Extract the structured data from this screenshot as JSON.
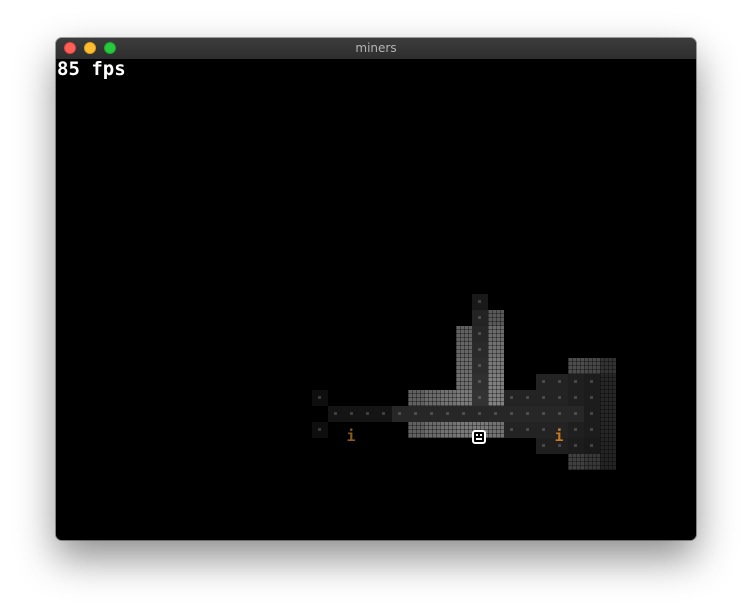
{
  "window": {
    "title": "miners"
  },
  "hud": {
    "fps_text": "85 fps"
  },
  "colors": {
    "torch": "#c87820",
    "player": "#ffffff",
    "wall": "#6a6a6a",
    "floor": "#2a2a2a"
  },
  "map": {
    "items": [
      {
        "name": "torch-item",
        "glyph": "i"
      },
      {
        "name": "torch-item",
        "glyph": "i"
      }
    ]
  }
}
